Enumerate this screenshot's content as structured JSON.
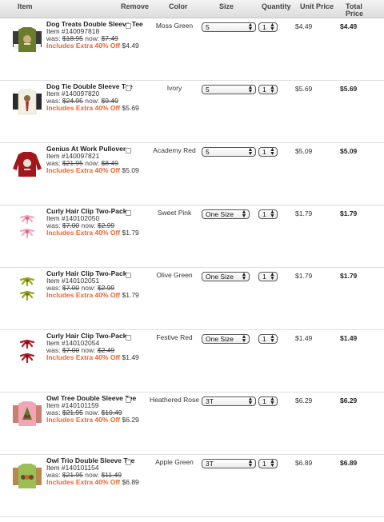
{
  "header": {
    "item": "Item",
    "remove": "Remove",
    "color": "Color",
    "size": "Size",
    "quantity": "Quantity",
    "unit_price": "Unit Price",
    "total_price": "Total Price"
  },
  "items": [
    {
      "name": "Dog Treats Double Sleeve Tee",
      "item_no": "Item #140097818",
      "was_label": "was:",
      "was_price": "$18.95",
      "now_label": "now:",
      "now_price": "$7.49",
      "promo": "Includes Extra 40% Off",
      "promo_price": "$4.49",
      "color": "Moss Green",
      "size": "5",
      "qty": "1",
      "unit_price": "$4.49",
      "total_price": "$4.49",
      "thumb_icon": "green-tee-thumbnail"
    },
    {
      "name": "Dog Tie Double Sleeve Tee",
      "item_no": "Item #140097820",
      "was_label": "was:",
      "was_price": "$24.95",
      "now_label": "now:",
      "now_price": "$9.49",
      "promo": "Includes Extra 40% Off",
      "promo_price": "$5.69",
      "color": "Ivory",
      "size": "5",
      "qty": "1",
      "unit_price": "$5.69",
      "total_price": "$5.69",
      "thumb_icon": "ivory-tee-thumbnail"
    },
    {
      "name": "Genius At Work Pullover",
      "item_no": "Item #140097821",
      "was_label": "was:",
      "was_price": "$21.95",
      "now_label": "now:",
      "now_price": "$8.49",
      "promo": "Includes Extra 40% Off",
      "promo_price": "$5.09",
      "color": "Academy Red",
      "size": "5",
      "qty": "1",
      "unit_price": "$5.09",
      "total_price": "$5.09",
      "thumb_icon": "red-pullover-thumbnail"
    },
    {
      "name": "Curly Hair Clip Two-Pack",
      "item_no": "Item #140102050",
      "was_label": "was:",
      "was_price": "$7.00",
      "now_label": "now:",
      "now_price": "$2.99",
      "promo": "Includes Extra 40% Off",
      "promo_price": "$1.79",
      "color": "Sweet Pink",
      "size": "One Size",
      "qty": "1",
      "unit_price": "$1.79",
      "total_price": "$1.79",
      "thumb_icon": "pink-hair-clip-thumbnail"
    },
    {
      "name": "Curly Hair Clip Two-Pack",
      "item_no": "Item #140102051",
      "was_label": "was:",
      "was_price": "$7.00",
      "now_label": "now:",
      "now_price": "$2.99",
      "promo": "Includes Extra 40% Off",
      "promo_price": "$1.79",
      "color": "Olive Green",
      "size": "One Size",
      "qty": "1",
      "unit_price": "$1.79",
      "total_price": "$1.79",
      "thumb_icon": "olive-hair-clip-thumbnail"
    },
    {
      "name": "Curly Hair Clip Two-Pack",
      "item_no": "Item #140102054",
      "was_label": "was:",
      "was_price": "$7.00",
      "now_label": "now:",
      "now_price": "$2.49",
      "promo": "Includes Extra 40% Off",
      "promo_price": "$1.49",
      "color": "Festive Red",
      "size": "One Size",
      "qty": "1",
      "unit_price": "$1.49",
      "total_price": "$1.49",
      "thumb_icon": "red-hair-clip-thumbnail"
    },
    {
      "name": "Owl Tree Double Sleeve Tee",
      "item_no": "Item #140101159",
      "was_label": "was:",
      "was_price": "$21.95",
      "now_label": "now:",
      "now_price": "$10.49",
      "promo": "Includes Extra 40% Off",
      "promo_price": "$6.29",
      "color": "Heathered Rose",
      "size": "3T",
      "qty": "1",
      "unit_price": "$6.29",
      "total_price": "$6.29",
      "thumb_icon": "pink-owl-tee-thumbnail"
    },
    {
      "name": "Owl Trio Double Sleeve Tee",
      "item_no": "Item #140101154",
      "was_label": "was:",
      "was_price": "$21.95",
      "now_label": "now:",
      "now_price": "$11.49",
      "promo": "Includes Extra 40% Off",
      "promo_price": "$6.89",
      "color": "Apple Green",
      "size": "3T",
      "qty": "1",
      "unit_price": "$6.89",
      "total_price": "$6.89",
      "thumb_icon": "green-owl-tee-thumbnail"
    }
  ]
}
